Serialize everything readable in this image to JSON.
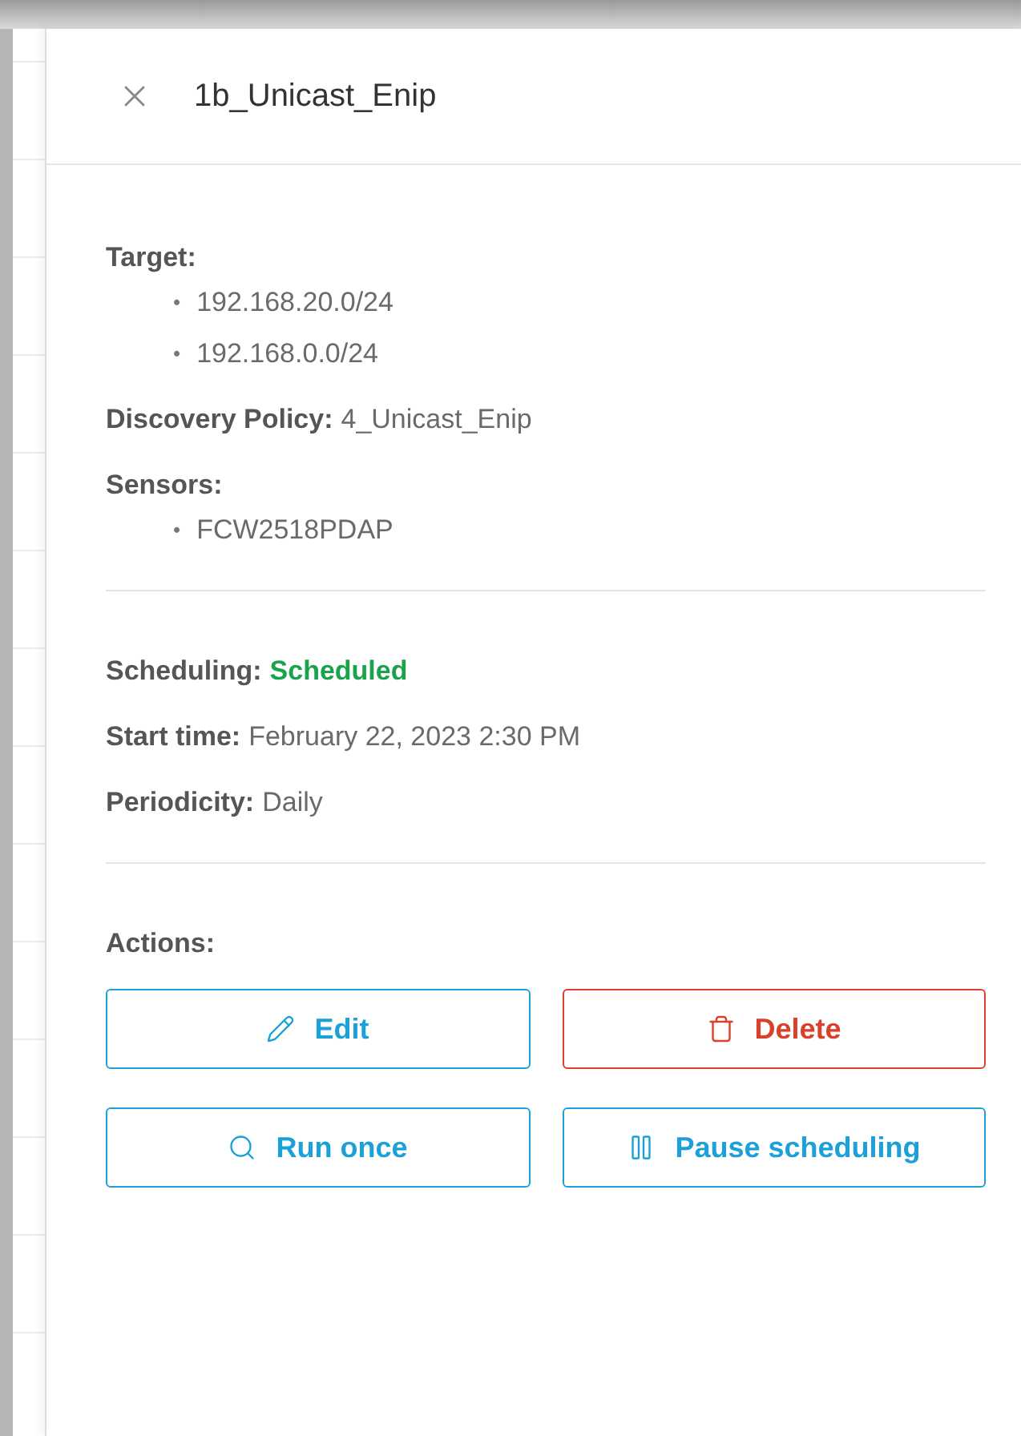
{
  "panel": {
    "title": "1b_Unicast_Enip"
  },
  "details": [
    {
      "kind": "list",
      "label": "Target:",
      "bullet": "•",
      "items": [
        "192.168.20.0/24",
        "192.168.0.0/24"
      ]
    },
    {
      "kind": "pair",
      "label": "Discovery Policy:",
      "value": "4_Unicast_Enip"
    },
    {
      "kind": "list",
      "label": "Sensors:",
      "bullet": "•",
      "items": [
        "FCW2518PDAP"
      ]
    }
  ],
  "schedule": [
    {
      "kind": "status",
      "label": "Scheduling:",
      "value": "Scheduled"
    },
    {
      "kind": "pair",
      "label": "Start time:",
      "value": "February 22, 2023 2:30 PM"
    },
    {
      "kind": "pair",
      "label": "Periodicity:",
      "value": "Daily"
    }
  ],
  "actions": {
    "label": "Actions:",
    "buttons": [
      {
        "label": "Edit",
        "kind": "edit"
      },
      {
        "label": "Delete",
        "kind": "delete"
      },
      {
        "label": "Run once",
        "kind": "run"
      },
      {
        "label": "Pause scheduling",
        "kind": "pause"
      }
    ]
  }
}
